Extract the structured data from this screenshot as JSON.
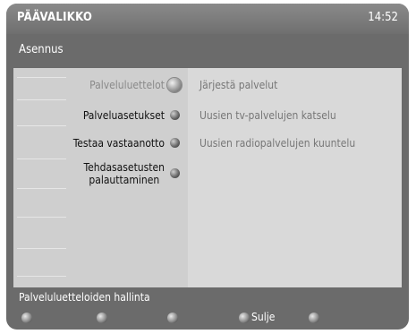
{
  "header": {
    "title": "PÄÄVALIKKO",
    "clock": "14:52"
  },
  "subtitle": "Asennus",
  "menu": {
    "items": [
      {
        "label": "Palveluluettelot",
        "active": true
      },
      {
        "label": "Palveluasetukset",
        "active": false
      },
      {
        "label": "Testaa vastaanotto",
        "active": false
      },
      {
        "label_line1": "Tehdasasetusten",
        "label_line2": "palauttaminen",
        "active": false
      }
    ]
  },
  "submenu": {
    "items": [
      {
        "label": "Järjestä palvelut"
      },
      {
        "label": "Uusien tv-palvelujen katselu"
      },
      {
        "label": "Uusien radiopalvelujen kuuntelu"
      }
    ]
  },
  "status_text": "Palveluluetteloiden hallinta",
  "footer": {
    "close_label": "Sulje"
  }
}
